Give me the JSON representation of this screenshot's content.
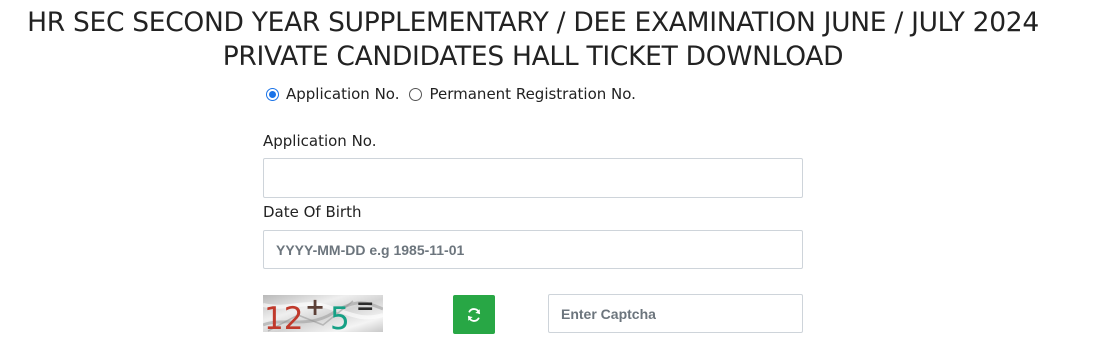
{
  "header": {
    "title_line1": "HR SEC SECOND YEAR SUPPLEMENTARY / DEE EXAMINATION JUNE / JULY 2024",
    "title_line2": "PRIVATE CANDIDATES HALL TICKET DOWNLOAD"
  },
  "search_type": {
    "options": [
      {
        "label": "Application No.",
        "selected": true
      },
      {
        "label": "Permanent Registration No.",
        "selected": false
      }
    ]
  },
  "form": {
    "application_no": {
      "label": "Application No.",
      "value": "",
      "placeholder": ""
    },
    "dob": {
      "label": "Date Of Birth",
      "value": "",
      "placeholder": "YYYY-MM-DD e.g 1985-11-01"
    },
    "captcha": {
      "num1": "12",
      "operator": "+",
      "num2": "5",
      "equals": "=",
      "input_placeholder": "Enter Captcha",
      "refresh_icon": "refresh-icon"
    }
  },
  "colors": {
    "accent_radio": "#1a73e8",
    "refresh_button": "#28a745",
    "captcha_num1": "#c0392b",
    "captcha_num2": "#16a085"
  }
}
